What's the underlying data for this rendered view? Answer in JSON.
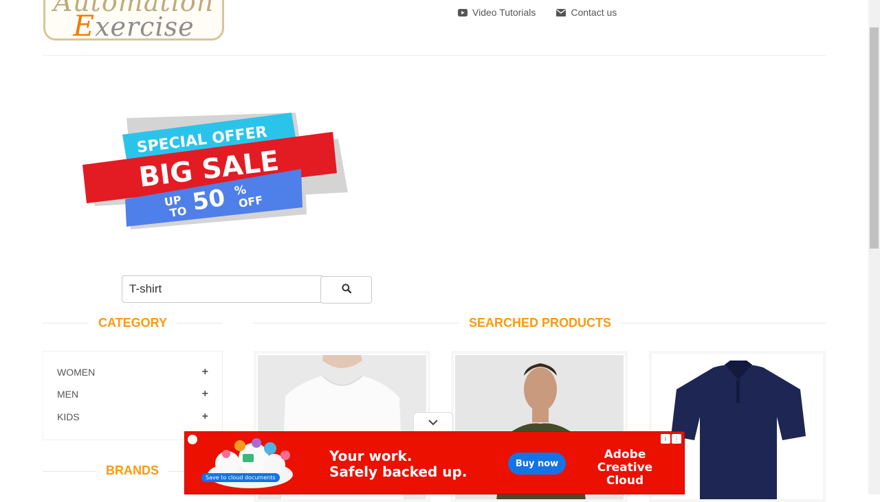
{
  "logo": {
    "line1": "Automation",
    "line2_cap": "E",
    "line2_rest": "xercise"
  },
  "nav": [
    {
      "label": "Video Tutorials",
      "icon": "youtube-play-icon"
    },
    {
      "label": "Contact us",
      "icon": "envelope-icon"
    }
  ],
  "banner": {
    "line1": "SPECIAL OFFER",
    "line2": "BIG SALE",
    "up": "UP",
    "to": "TO",
    "percent": "50",
    "pct_sign": "%",
    "off": "OFF"
  },
  "search": {
    "value": "T-shirt",
    "icon": "search-icon"
  },
  "category": {
    "title": "CATEGORY",
    "items": [
      {
        "label": "WOMEN"
      },
      {
        "label": "MEN"
      },
      {
        "label": "KIDS"
      }
    ]
  },
  "brands": {
    "title": "BRANDS"
  },
  "products": {
    "title": "SEARCHED PRODUCTS"
  },
  "ad": {
    "headline1": "Your work.",
    "headline2": "Safely backed up.",
    "button": "Buy now",
    "brand1": "Adobe",
    "brand2": "Creative Cloud",
    "small_cta": "Save to cloud documents"
  },
  "colors": {
    "accent": "#fe980f",
    "ad_bg": "#eb1000",
    "ad_button": "#1473e6",
    "banner_red": "#e31b23",
    "banner_cyan": "#2ac4ea",
    "banner_blue": "#4f7fe8"
  }
}
